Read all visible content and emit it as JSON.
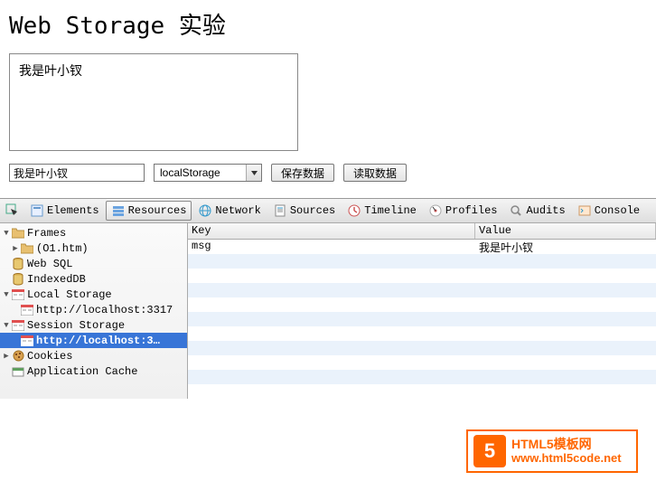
{
  "page": {
    "title": "Web Storage 实验",
    "display_text": "我是叶小钗"
  },
  "controls": {
    "input_value": "我是叶小钗",
    "select_value": "localStorage",
    "save_btn": "保存数据",
    "read_btn": "读取数据"
  },
  "devtools": {
    "tabs": [
      "Elements",
      "Resources",
      "Network",
      "Sources",
      "Timeline",
      "Profiles",
      "Audits",
      "Console"
    ],
    "active_tab": "Resources",
    "sidebar": {
      "frames": {
        "label": "Frames",
        "children": [
          "(O1.htm)"
        ]
      },
      "items": [
        "Web SQL",
        "IndexedDB"
      ],
      "local_storage": {
        "label": "Local Storage",
        "children": [
          "http://localhost:3317"
        ]
      },
      "session_storage": {
        "label": "Session Storage",
        "children": [
          "http://localhost:3…"
        ]
      },
      "items2": [
        "Cookies",
        "Application Cache"
      ]
    },
    "grid": {
      "headers": [
        "Key",
        "Value"
      ],
      "rows": [
        {
          "key": "msg",
          "value": "我是叶小钗"
        }
      ]
    }
  },
  "watermark": {
    "logo_text": "5",
    "line1": "HTML5模板网",
    "line2": "www.html5code.net"
  }
}
